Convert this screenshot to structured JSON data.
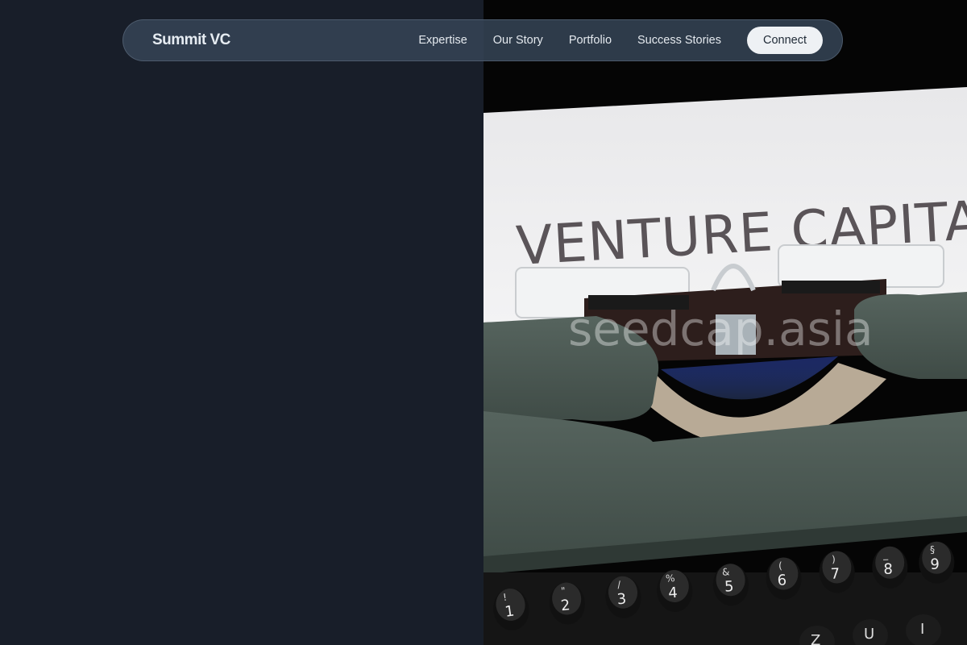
{
  "brand": {
    "name": "Summit VC"
  },
  "nav": {
    "links": [
      "Expertise",
      "Our Story",
      "Portfolio",
      "Success Stories"
    ],
    "cta_label": "Connect"
  },
  "hero": {
    "image_paper_text": "VENTURE CAPITAL",
    "image_watermark": "seedcap.asia",
    "keys": [
      "!\n1",
      "\"\n2",
      "/\n3",
      "%\n4",
      "&\n5",
      "(\n6",
      ")\n7",
      "_\n8",
      "§\n9"
    ]
  },
  "colors": {
    "page_bg": "#181e29",
    "navbar_bg": "#344354",
    "cta_bg": "#eef1f4",
    "typewriter_body": "#4b5953"
  }
}
